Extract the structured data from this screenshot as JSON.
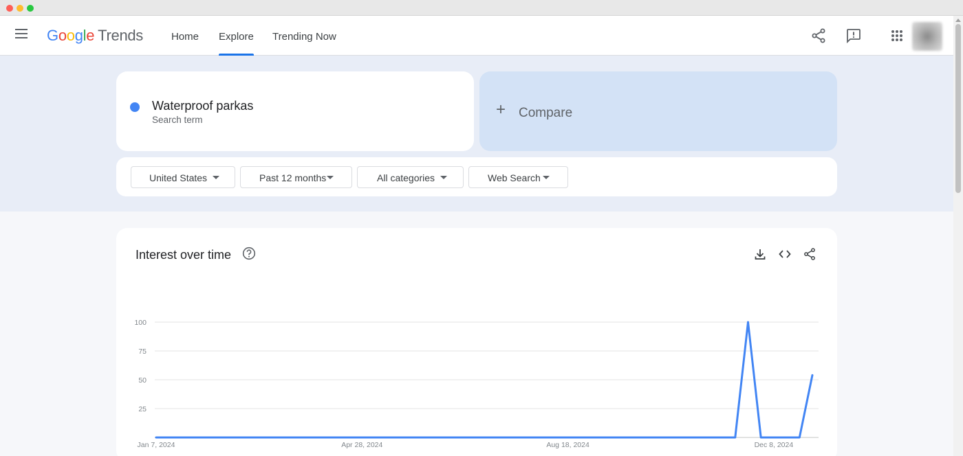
{
  "header": {
    "logo_google": "Google",
    "logo_trends": "Trends",
    "tabs": [
      {
        "label": "Home",
        "active": false
      },
      {
        "label": "Explore",
        "active": true
      },
      {
        "label": "Trending Now",
        "active": false
      }
    ],
    "icons": [
      "menu-icon",
      "share-icon",
      "feedback-icon",
      "apps-icon"
    ],
    "accent_color": "#1a73e8"
  },
  "search_term": {
    "name": "Waterproof parkas",
    "type": "Search term",
    "color": "#4285f4"
  },
  "compare": {
    "label": "Compare",
    "icon": "plus-icon"
  },
  "filters": [
    {
      "label": "United States"
    },
    {
      "label": "Past 12 months"
    },
    {
      "label": "All categories"
    },
    {
      "label": "Web Search"
    }
  ],
  "interest_card": {
    "title": "Interest over time",
    "icons": [
      "help-icon",
      "download-icon",
      "embed-icon",
      "share-icon"
    ]
  },
  "chart_data": {
    "type": "line",
    "title": "",
    "xlabel": "",
    "ylabel": "",
    "ylim": [
      0,
      100
    ],
    "yticks": [
      25,
      50,
      75,
      100
    ],
    "x_tick_labels": [
      "Jan 7, 2024",
      "Apr 28, 2024",
      "Aug 18, 2024",
      "Dec 8, 2024"
    ],
    "grid": true,
    "x": [
      "2024-01-07",
      "2024-01-14",
      "2024-01-21",
      "2024-01-28",
      "2024-02-04",
      "2024-02-11",
      "2024-02-18",
      "2024-02-25",
      "2024-03-03",
      "2024-03-10",
      "2024-03-17",
      "2024-03-24",
      "2024-03-31",
      "2024-04-07",
      "2024-04-14",
      "2024-04-21",
      "2024-04-28",
      "2024-05-05",
      "2024-05-12",
      "2024-05-19",
      "2024-05-26",
      "2024-06-02",
      "2024-06-09",
      "2024-06-16",
      "2024-06-23",
      "2024-06-30",
      "2024-07-07",
      "2024-07-14",
      "2024-07-21",
      "2024-07-28",
      "2024-08-04",
      "2024-08-11",
      "2024-08-18",
      "2024-08-25",
      "2024-09-01",
      "2024-09-08",
      "2024-09-15",
      "2024-09-22",
      "2024-09-29",
      "2024-10-06",
      "2024-10-13",
      "2024-10-20",
      "2024-10-27",
      "2024-11-03",
      "2024-11-10",
      "2024-11-17",
      "2024-11-24",
      "2024-12-01",
      "2024-12-08",
      "2024-12-15",
      "2024-12-22",
      "2024-12-29"
    ],
    "series": [
      {
        "color": "#4285f4",
        "values": [
          0,
          0,
          0,
          0,
          0,
          0,
          0,
          0,
          0,
          0,
          0,
          0,
          0,
          0,
          0,
          0,
          0,
          0,
          0,
          0,
          0,
          0,
          0,
          0,
          0,
          0,
          0,
          0,
          0,
          0,
          0,
          0,
          0,
          0,
          0,
          0,
          0,
          0,
          0,
          0,
          0,
          0,
          0,
          0,
          0,
          0,
          100,
          0,
          0,
          0,
          0,
          54
        ]
      }
    ]
  }
}
